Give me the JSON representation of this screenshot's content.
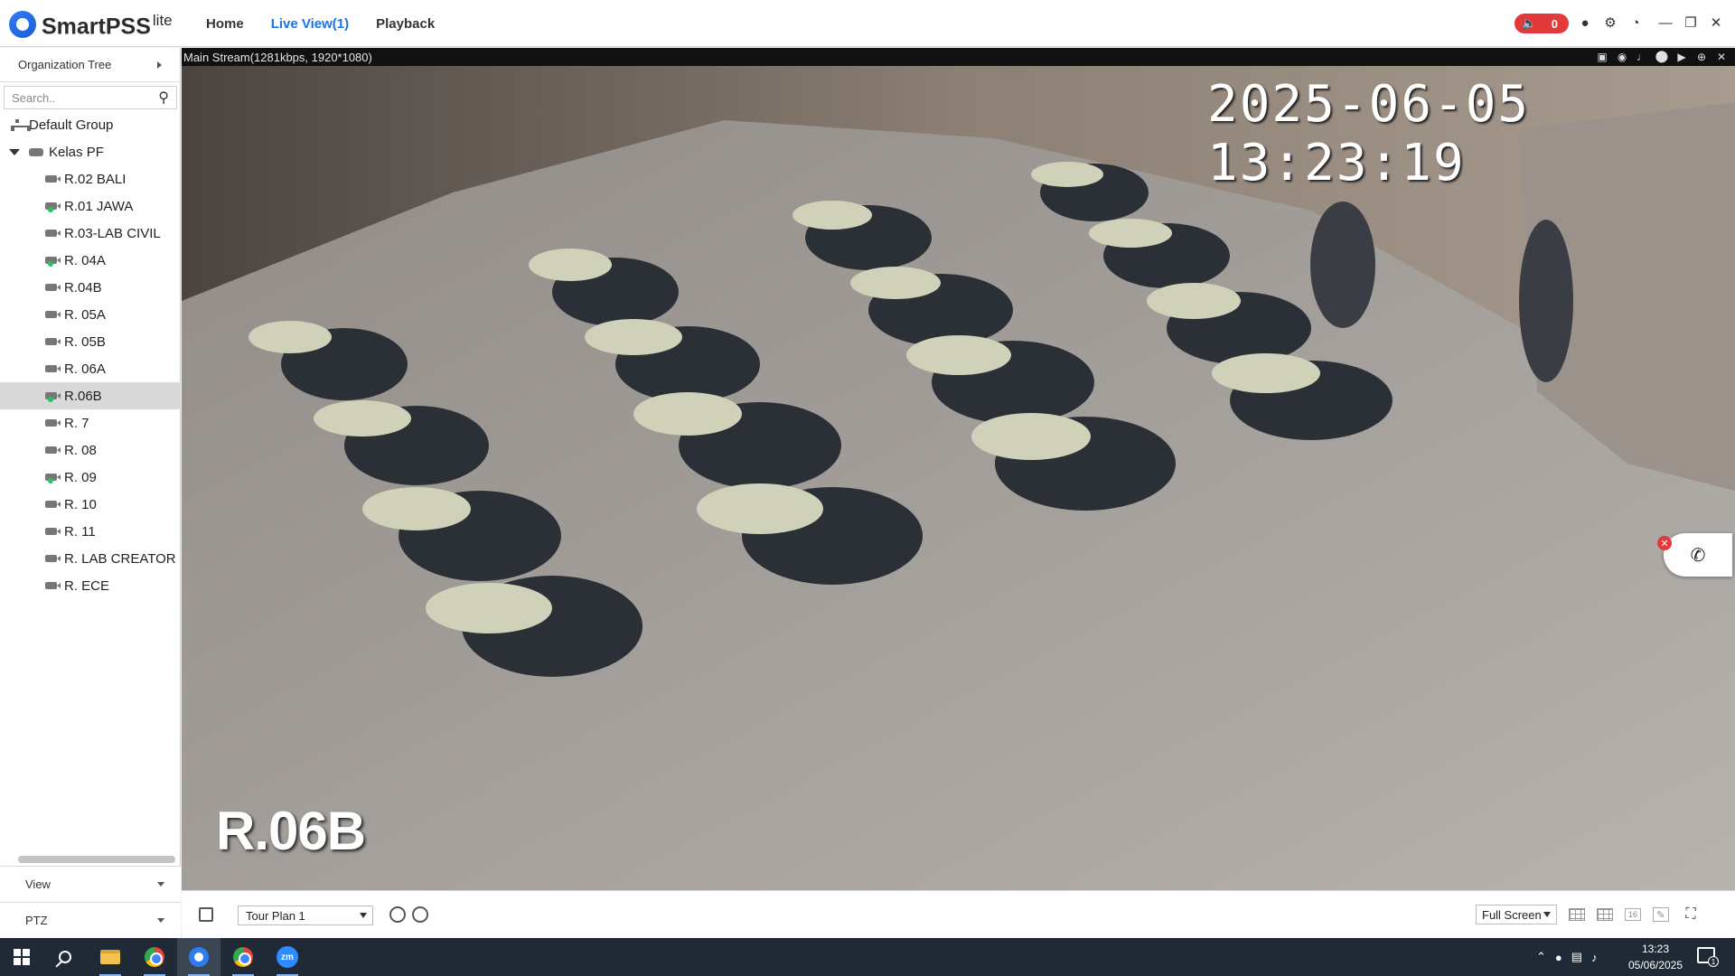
{
  "header": {
    "brand": "SmartPSS",
    "brand_sub": "lite",
    "nav": [
      {
        "label": "Home",
        "active": false
      },
      {
        "label": "Live View(1)",
        "active": true
      },
      {
        "label": "Playback",
        "active": false
      }
    ],
    "alarm_count": "0"
  },
  "sidebar": {
    "org_tree_label": "Organization Tree",
    "search_placeholder": "Search..",
    "tree": {
      "root": "Default Group",
      "group": "Kelas PF",
      "cameras": [
        {
          "label": "R.02 BALI",
          "online": false
        },
        {
          "label": "R.01 JAWA",
          "online": true
        },
        {
          "label": "R.03-LAB CIVIL",
          "online": false
        },
        {
          "label": "R. 04A",
          "online": true
        },
        {
          "label": "R.04B",
          "online": false
        },
        {
          "label": "R. 05A",
          "online": false
        },
        {
          "label": "R. 05B",
          "online": false
        },
        {
          "label": "R. 06A",
          "online": false
        },
        {
          "label": "R.06B",
          "online": true,
          "selected": true
        },
        {
          "label": "R. 7",
          "online": false
        },
        {
          "label": "R. 08",
          "online": false
        },
        {
          "label": "R. 09",
          "online": true
        },
        {
          "label": "R. 10",
          "online": false
        },
        {
          "label": "R. 11",
          "online": false
        },
        {
          "label": "R. LAB CREATOR",
          "online": false
        },
        {
          "label": "R. ECE",
          "online": false
        }
      ]
    },
    "view_label": "View",
    "ptz_label": "PTZ"
  },
  "video": {
    "stream_info": "Main Stream(1281kbps, 1920*1080)",
    "timestamp": "2025-06-05 13:23:19",
    "camera_overlay": "R.06B"
  },
  "bottom_bar": {
    "tour_plan": "Tour Plan 1",
    "layout_mode": "Full Screen",
    "grid_16_label": "16"
  },
  "taskbar": {
    "zoom_label": "zm",
    "time": "13:23",
    "date": "05/06/2025",
    "notification_count": "1"
  },
  "colors": {
    "accent": "#1a73e8",
    "alarm": "#e23a3a",
    "online": "#22c55e",
    "taskbar": "#202a36"
  }
}
